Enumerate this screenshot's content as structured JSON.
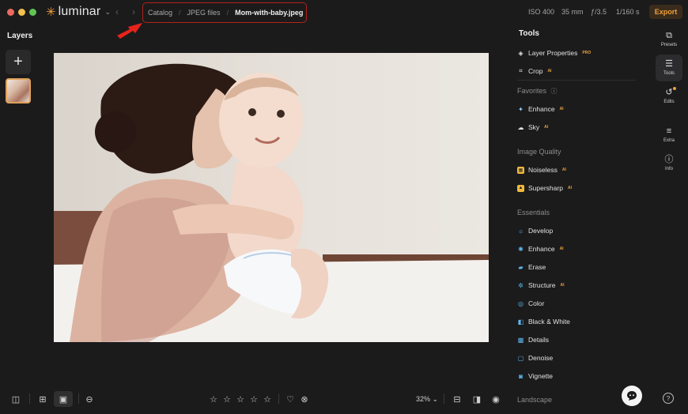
{
  "app": {
    "name": "luminar",
    "brand_color": "#f2a03d"
  },
  "breadcrumb": {
    "items": [
      "Catalog",
      "JPEG files",
      "Mom-with-baby.jpeg"
    ]
  },
  "exif": {
    "iso": "ISO 400",
    "focal": "35 mm",
    "aperture": "ƒ/3.5",
    "shutter": "1/160 s"
  },
  "toolbar": {
    "export_label": "Export"
  },
  "layers": {
    "title": "Layers",
    "add_label": "+"
  },
  "tools": {
    "title": "Tools",
    "top": [
      {
        "label": "Layer Properties",
        "badge": "PRO",
        "icon": "layers-icon"
      },
      {
        "label": "Crop",
        "badge": "AI",
        "icon": "crop-icon"
      }
    ],
    "favorites_title": "Favorites",
    "favorites": [
      {
        "label": "Enhance",
        "badge": "AI",
        "icon": "enhance-icon"
      },
      {
        "label": "Sky",
        "badge": "AI",
        "icon": "cloud-icon"
      }
    ],
    "image_quality_title": "Image Quality",
    "image_quality": [
      {
        "label": "Noiseless",
        "badge": "AI",
        "icon": "noiseless-icon"
      },
      {
        "label": "Supersharp",
        "badge": "AI",
        "icon": "supersharp-icon"
      }
    ],
    "essentials_title": "Essentials",
    "essentials": [
      {
        "label": "Develop",
        "badge": "",
        "icon": "develop-icon"
      },
      {
        "label": "Enhance",
        "badge": "AI",
        "icon": "enhance-icon"
      },
      {
        "label": "Erase",
        "badge": "",
        "icon": "erase-icon"
      },
      {
        "label": "Structure",
        "badge": "AI",
        "icon": "structure-icon"
      },
      {
        "label": "Color",
        "badge": "",
        "icon": "color-icon"
      },
      {
        "label": "Black & White",
        "badge": "",
        "icon": "bw-icon"
      },
      {
        "label": "Details",
        "badge": "",
        "icon": "details-icon"
      },
      {
        "label": "Denoise",
        "badge": "",
        "icon": "denoise-icon"
      },
      {
        "label": "Vignette",
        "badge": "",
        "icon": "vignette-icon"
      }
    ],
    "landscape_title": "Landscape"
  },
  "rail": [
    {
      "label": "Presets",
      "icon": "presets-icon"
    },
    {
      "label": "Tools",
      "icon": "sliders-icon"
    },
    {
      "label": "Edits",
      "icon": "history-icon"
    },
    {
      "label": "Extra",
      "icon": "list-icon"
    },
    {
      "label": "Info",
      "icon": "info-icon"
    }
  ],
  "bottom": {
    "zoom": "32%"
  }
}
